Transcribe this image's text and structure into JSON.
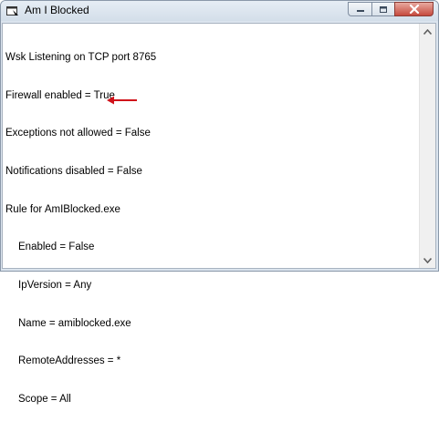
{
  "window": {
    "title": "Am I Blocked",
    "icon": "app-window-icon"
  },
  "controls": {
    "minimize_icon": "minimize-icon",
    "maximize_icon": "maximize-icon",
    "close_icon": "close-icon"
  },
  "output": {
    "lines": [
      "Wsk Listening on TCP port 8765",
      "Firewall enabled = True",
      "Exceptions not allowed = False",
      "Notifications disabled = False",
      "Rule for AmIBlocked.exe",
      "Enabled = False",
      "IpVersion = Any",
      "Name = amiblocked.exe",
      "RemoteAddresses = *",
      "Scope = All"
    ]
  },
  "annotation": {
    "icon": "left-arrow-icon",
    "color": "#d0121a"
  },
  "scrollbar": {
    "up_icon": "scroll-up-arrow-icon",
    "down_icon": "scroll-down-arrow-icon"
  }
}
